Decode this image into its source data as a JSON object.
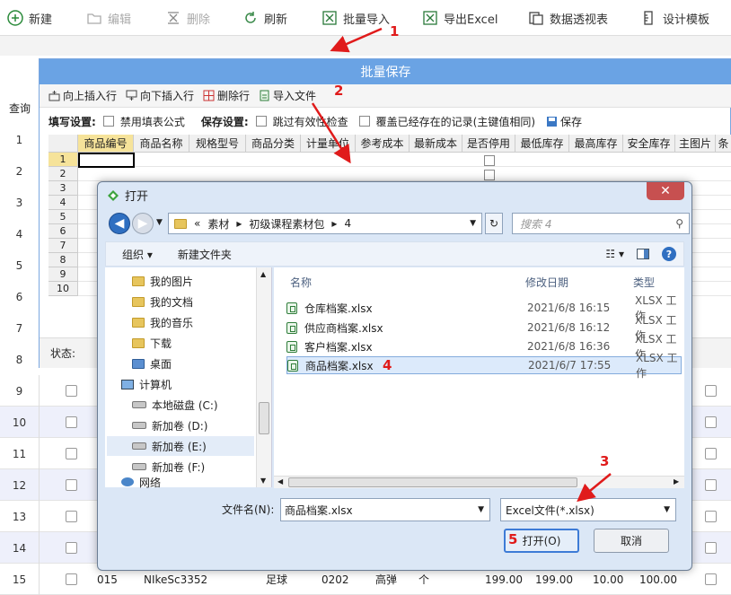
{
  "toolbar": {
    "new": "新建",
    "edit": "编辑",
    "delete": "删除",
    "refresh": "刷新",
    "batch_import": "批量导入",
    "export_excel": "导出Excel",
    "pivot": "数据透视表",
    "design": "设计模板"
  },
  "bg": {
    "query_label": "查询",
    "rows": [
      "1",
      "2",
      "3",
      "4",
      "5",
      "6",
      "7",
      "8",
      "9",
      "10",
      "11",
      "12",
      "13",
      "14",
      "15"
    ],
    "row15": {
      "code": "015",
      "name": "NIkeSc3352",
      "type": "足球",
      "unit_code": "0202",
      "brand": "高弹",
      "unit": "个",
      "p1": "199.00",
      "p2": "199.00",
      "p3": "10.00",
      "p4": "100.00"
    }
  },
  "batch": {
    "title": "批量保存",
    "insert_above": "向上插入行",
    "insert_below": "向下插入行",
    "delete_row": "删除行",
    "import_file": "导入文件",
    "fill_settings": "填写设置:",
    "disable_formula": "禁用填表公式",
    "save_settings": "保存设置:",
    "skip_invalid": "跳过有效性检查",
    "overwrite": "覆盖已经存在的记录(主键值相同)",
    "save": "保存",
    "columns": [
      "商品编号",
      "商品名称",
      "规格型号",
      "商品分类",
      "计量单位",
      "参考成本",
      "最新成本",
      "是否停用",
      "最低库存",
      "最高库存",
      "安全库存",
      "主图片",
      "条"
    ],
    "row_numbers": [
      "1",
      "2",
      "3",
      "4",
      "5",
      "6",
      "7",
      "8",
      "9",
      "10"
    ],
    "status_label": "状态:"
  },
  "dialog": {
    "title": "打开",
    "path": [
      "«",
      "素材",
      "初级课程素材包",
      "4"
    ],
    "search_placeholder": "搜索 4",
    "organize": "组织 ▾",
    "new_folder": "新建文件夹",
    "nav_items": [
      "我的图片",
      "我的文档",
      "我的音乐",
      "下载",
      "桌面",
      "计算机",
      "本地磁盘 (C:)",
      "新加卷 (D:)",
      "新加卷 (E:)",
      "新加卷 (F:)",
      "网络"
    ],
    "col_name": "名称",
    "col_date": "修改日期",
    "col_type": "类型",
    "files": [
      {
        "name": "仓库档案.xlsx",
        "date": "2021/6/8 16:15",
        "type": "XLSX 工作"
      },
      {
        "name": "供应商档案.xlsx",
        "date": "2021/6/8 16:12",
        "type": "XLSX 工作"
      },
      {
        "name": "客户档案.xlsx",
        "date": "2021/6/8 16:36",
        "type": "XLSX 工作"
      },
      {
        "name": "商品档案.xlsx",
        "date": "2021/6/7 17:55",
        "type": "XLSX 工作"
      }
    ],
    "filename_label": "文件名(N):",
    "filename_value": "商品档案.xlsx",
    "filetype_value": "Excel文件(*.xlsx)",
    "open": "打开(O)",
    "cancel": "取消"
  },
  "annotations": [
    "1",
    "2",
    "3",
    "4",
    "5"
  ]
}
